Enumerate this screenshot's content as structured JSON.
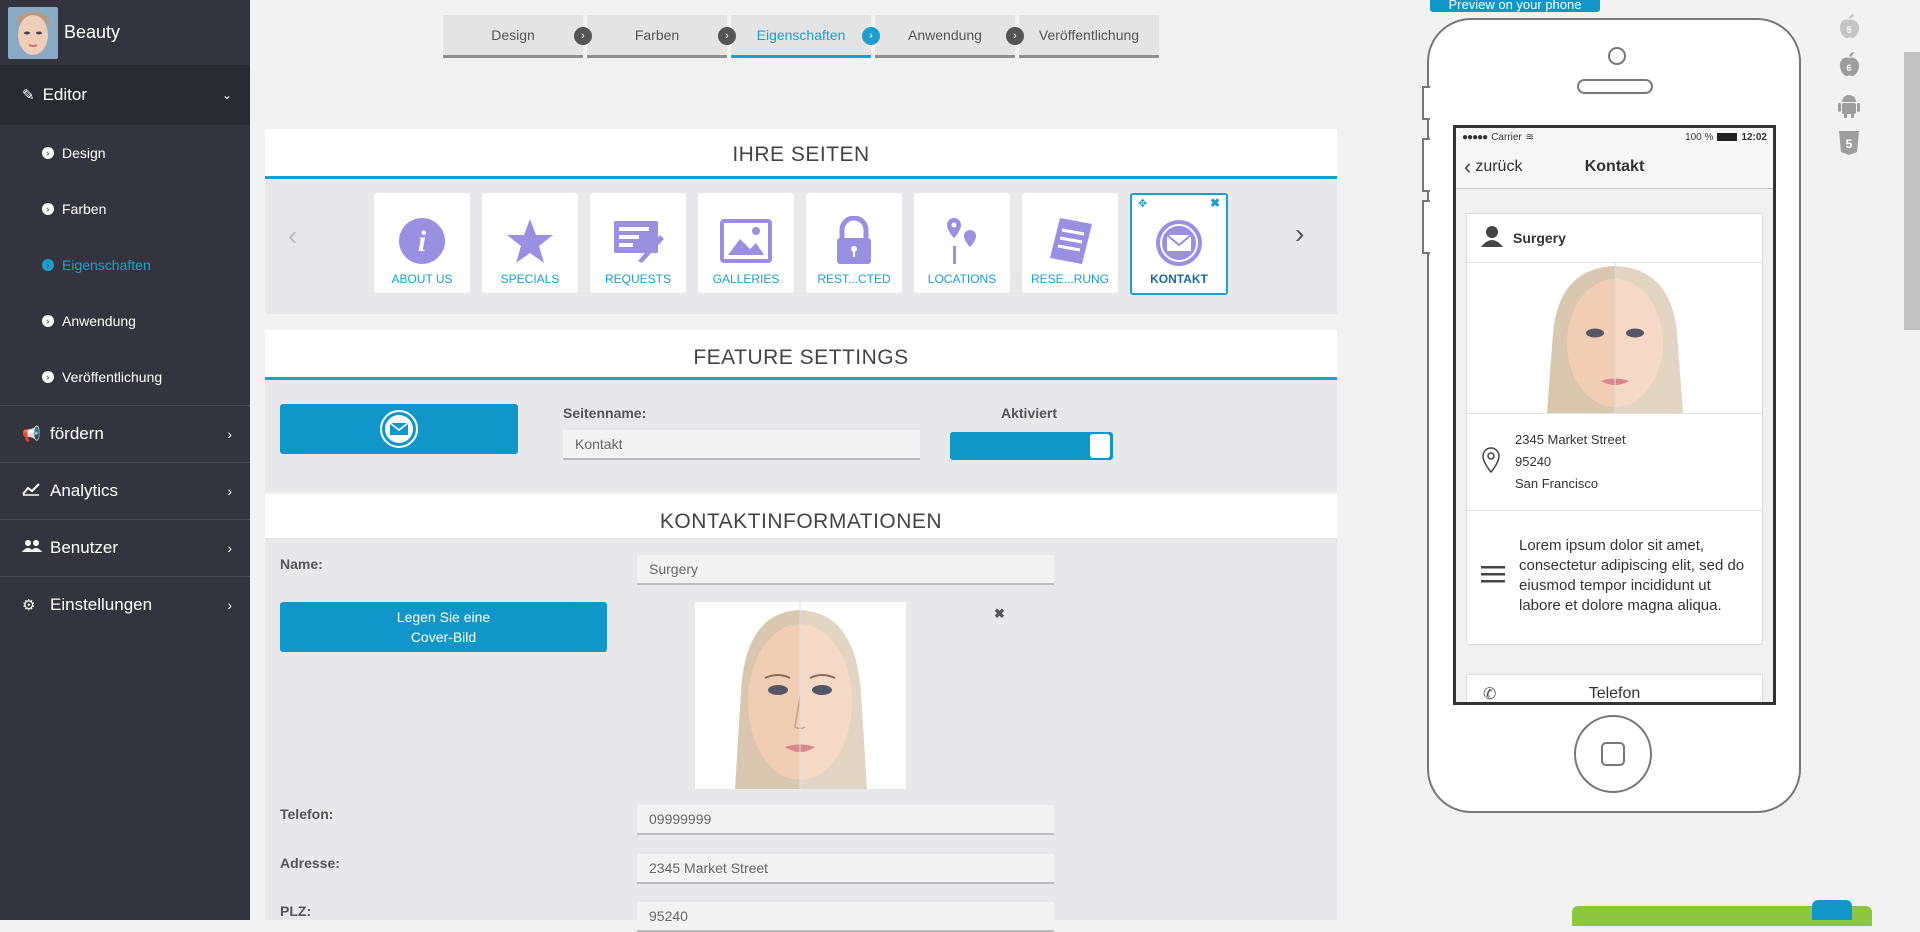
{
  "app": {
    "name": "Beauty"
  },
  "sidebar": {
    "editor": "Editor",
    "sub_items": [
      "Design",
      "Farben",
      "Eigenschaften",
      "Anwendung",
      "Veröffentlichung"
    ],
    "active_sub": "Eigenschaften",
    "top_items": [
      {
        "label": "fördern",
        "icon": "megaphone-icon"
      },
      {
        "label": "Analytics",
        "icon": "chart-line-icon"
      },
      {
        "label": "Benutzer",
        "icon": "users-icon"
      },
      {
        "label": "Einstellungen",
        "icon": "gears-icon"
      }
    ]
  },
  "steps": [
    "Design",
    "Farben",
    "Eigenschaften",
    "Anwendung",
    "Veröffentlichung"
  ],
  "active_step": "Eigenschaften",
  "pages_section": {
    "title": "IHRE SEITEN",
    "features": [
      "ABOUT US",
      "SPECIALS",
      "REQUESTS",
      "GALLERIES",
      "REST...CTED",
      "LOCATIONS",
      "RESE...RUNG",
      "KONTAKT"
    ],
    "selected": "KONTAKT"
  },
  "feature_settings": {
    "title": "FEATURE SETTINGS",
    "page_name_label": "Seitenname:",
    "page_name_value": "Kontakt",
    "activated_label": "Aktiviert",
    "activated": true
  },
  "contact": {
    "title": "KONTAKTINFORMATIONEN",
    "name_label": "Name:",
    "name_value": "Surgery",
    "cover_button_line1": "Legen Sie eine",
    "cover_button_line2": "Cover-Bild",
    "phone_label": "Telefon:",
    "phone_value": "09999999",
    "address_label": "Adresse:",
    "address_value": "2345 Market Street",
    "zip_label": "PLZ:",
    "zip_value": "95240"
  },
  "preview": {
    "button": "Preview on your phone",
    "status_carrier": "Carrier",
    "status_battery": "100 %",
    "status_time": "12:02",
    "back": "zurück",
    "title": "Kontakt",
    "name": "Surgery",
    "address_line1": "2345 Market Street",
    "address_line2": "95240",
    "address_line3": "San Francisco",
    "description": "Lorem ipsum dolor sit amet, consectetur adipiscing elit, sed do eiusmod tempor incididunt ut labore et dolore magna aliqua.",
    "phone_button": "Telefon"
  },
  "platform_icons": [
    "apple-5-icon",
    "apple-6-icon",
    "android-icon",
    "html5-icon"
  ],
  "colors": {
    "accent": "#1b9fd0",
    "sidebar": "#34343f",
    "icon_purple": "#9a8fe0"
  }
}
